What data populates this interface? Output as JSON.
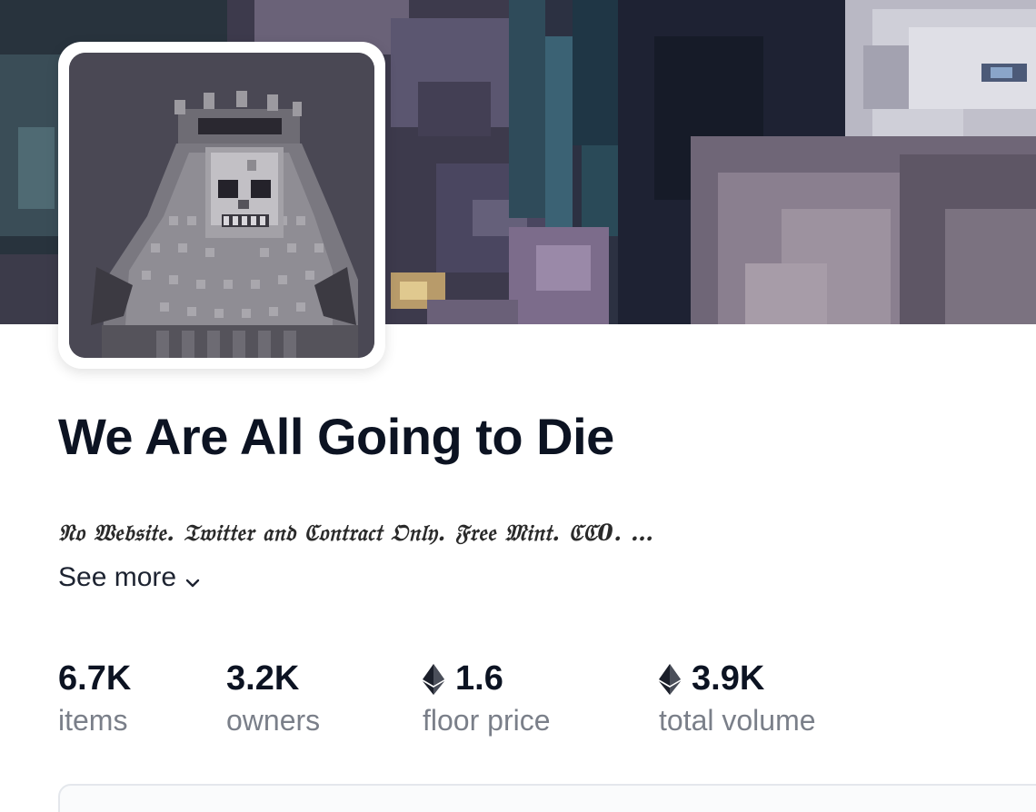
{
  "collection": {
    "title": "We Are All Going to Die",
    "description": "𝔑𝔬 𝔚𝔢𝔟𝔰𝔦𝔱𝔢. 𝔗𝔴𝔦𝔱𝔱𝔢𝔯 𝔞𝔫𝔡 ℭ𝔬𝔫𝔱𝔯𝔞𝔠𝔱 𝔒𝔫𝔩𝔶. 𝔉𝔯𝔢𝔢 𝔐𝔦𝔫𝔱. ℭℭ0. …",
    "see_more_label": "See more"
  },
  "stats": [
    {
      "value": "6.7K",
      "label": "items",
      "currency_icon": ""
    },
    {
      "value": "3.2K",
      "label": "owners",
      "currency_icon": ""
    },
    {
      "value": "1.6",
      "label": "floor price",
      "currency_icon": "ethereum-icon"
    },
    {
      "value": "3.9K",
      "label": "total volume",
      "currency_icon": "ethereum-icon"
    }
  ],
  "colors": {
    "title": "#0c1322",
    "label": "#7a7f89",
    "banner_dark": "#2b2f3f"
  }
}
